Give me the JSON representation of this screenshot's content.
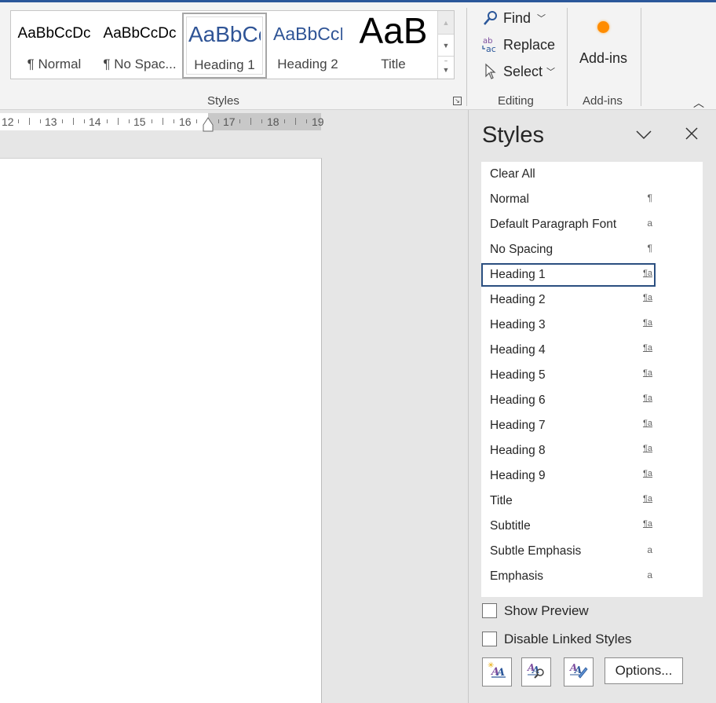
{
  "ribbon": {
    "styles_gallery": [
      {
        "preview": "AaBbCcDc",
        "label": "¶ Normal",
        "selected": false
      },
      {
        "preview": "AaBbCcDc",
        "label": "¶ No Spac...",
        "selected": false
      },
      {
        "preview": "AaBbCc",
        "label": "Heading 1",
        "selected": true
      },
      {
        "preview": "AaBbCcD",
        "label": "Heading 2",
        "selected": false
      },
      {
        "preview": "AaB",
        "label": "Title",
        "selected": false
      }
    ],
    "styles_group_label": "Styles",
    "editing": {
      "find_label": "Find",
      "replace_label": "Replace",
      "select_label": "Select",
      "group_label": "Editing"
    },
    "addins": {
      "button_label": "Add-ins",
      "group_label": "Add-ins"
    }
  },
  "ruler": {
    "numbers": [
      "12",
      "13",
      "14",
      "15",
      "16",
      "17",
      "18",
      "19"
    ]
  },
  "styles_pane": {
    "title": "Styles",
    "items": [
      {
        "name": "Clear All",
        "type": ""
      },
      {
        "name": "Normal",
        "type": "¶"
      },
      {
        "name": "Default Paragraph Font",
        "type": "a"
      },
      {
        "name": "No Spacing",
        "type": "¶"
      },
      {
        "name": "Heading 1",
        "type": "¶a",
        "selected": true
      },
      {
        "name": "Heading 2",
        "type": "¶a"
      },
      {
        "name": "Heading 3",
        "type": "¶a"
      },
      {
        "name": "Heading 4",
        "type": "¶a"
      },
      {
        "name": "Heading 5",
        "type": "¶a"
      },
      {
        "name": "Heading 6",
        "type": "¶a"
      },
      {
        "name": "Heading 7",
        "type": "¶a"
      },
      {
        "name": "Heading 8",
        "type": "¶a"
      },
      {
        "name": "Heading 9",
        "type": "¶a"
      },
      {
        "name": "Title",
        "type": "¶a"
      },
      {
        "name": "Subtitle",
        "type": "¶a"
      },
      {
        "name": "Subtle Emphasis",
        "type": "a"
      },
      {
        "name": "Emphasis",
        "type": "a"
      }
    ],
    "show_preview_label": "Show Preview",
    "show_preview_checked": false,
    "disable_linked_label": "Disable Linked Styles",
    "disable_linked_checked": false,
    "options_label": "Options...",
    "icon_buttons": [
      "new-style-icon",
      "style-inspector-icon",
      "manage-styles-icon"
    ]
  },
  "colors": {
    "accent": "#2b579a",
    "heading_blue": "#2f5496",
    "addins_dot": "#ff8c00"
  }
}
